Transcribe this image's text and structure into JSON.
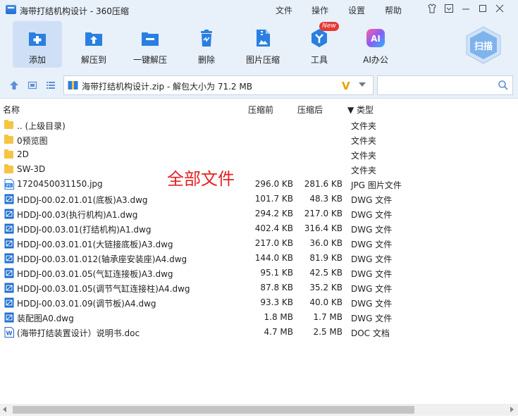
{
  "window": {
    "title": "海带打结机构设计 - 360压缩"
  },
  "menu": [
    "文件",
    "操作",
    "设置",
    "帮助"
  ],
  "toolbar": [
    {
      "label": "添加",
      "icon": "add-icon"
    },
    {
      "label": "解压到",
      "icon": "extract-to-icon"
    },
    {
      "label": "一键解压",
      "icon": "one-click-extract-icon"
    },
    {
      "label": "删除",
      "icon": "delete-icon"
    },
    {
      "label": "图片压缩",
      "icon": "image-compress-icon"
    },
    {
      "label": "工具",
      "icon": "tools-icon",
      "badge": "New"
    },
    {
      "label": "AI办公",
      "icon": "ai-office-icon"
    }
  ],
  "scan": {
    "label": "扫描"
  },
  "address": {
    "text": "海带打结机构设计.zip - 解包大小为 71.2 MB"
  },
  "search": {
    "placeholder": "",
    "value": ""
  },
  "columns": {
    "name": "名称",
    "compressed": "压缩前",
    "original": "压缩后",
    "type": "▼ 类型"
  },
  "overlay": "全部文件",
  "files": [
    {
      "name": ".. (上级目录)",
      "compressed": "",
      "original": "",
      "type": "文件夹",
      "kind": "folder"
    },
    {
      "name": "0预览图",
      "compressed": "",
      "original": "",
      "type": "文件夹",
      "kind": "folder"
    },
    {
      "name": "2D",
      "compressed": "",
      "original": "",
      "type": "文件夹",
      "kind": "folder"
    },
    {
      "name": "SW-3D",
      "compressed": "",
      "original": "",
      "type": "文件夹",
      "kind": "folder"
    },
    {
      "name": "1720450031150.jpg",
      "compressed": "296.0 KB",
      "original": "281.6 KB",
      "type": "JPG 图片文件",
      "kind": "jpg"
    },
    {
      "name": "HDDJ-00.02.01.01(底板)A3.dwg",
      "compressed": "101.7 KB",
      "original": "48.3 KB",
      "type": "DWG 文件",
      "kind": "dwg"
    },
    {
      "name": "HDDJ-00.03(执行机构)A1.dwg",
      "compressed": "294.2 KB",
      "original": "217.0 KB",
      "type": "DWG 文件",
      "kind": "dwg"
    },
    {
      "name": "HDDJ-00.03.01(打结机构)A1.dwg",
      "compressed": "402.4 KB",
      "original": "316.4 KB",
      "type": "DWG 文件",
      "kind": "dwg"
    },
    {
      "name": "HDDJ-00.03.01.01(大链接底板)A3.dwg",
      "compressed": "217.0 KB",
      "original": "36.0 KB",
      "type": "DWG 文件",
      "kind": "dwg"
    },
    {
      "name": "HDDJ-00.03.01.012(轴承座安装座)A4.dwg",
      "compressed": "144.0 KB",
      "original": "81.9 KB",
      "type": "DWG 文件",
      "kind": "dwg"
    },
    {
      "name": "HDDJ-00.03.01.05(气缸连接板)A3.dwg",
      "compressed": "95.1 KB",
      "original": "42.5 KB",
      "type": "DWG 文件",
      "kind": "dwg"
    },
    {
      "name": "HDDJ-00.03.01.05(调节气缸连接柱)A4.dwg",
      "compressed": "87.8 KB",
      "original": "35.2 KB",
      "type": "DWG 文件",
      "kind": "dwg"
    },
    {
      "name": "HDDJ-00.03.01.09(调节板)A4.dwg",
      "compressed": "93.3 KB",
      "original": "40.0 KB",
      "type": "DWG 文件",
      "kind": "dwg"
    },
    {
      "name": "装配图A0.dwg",
      "compressed": "1.8 MB",
      "original": "1.7 MB",
      "type": "DWG 文件",
      "kind": "dwg"
    },
    {
      "name": "(海带打结装置设计）说明书.doc",
      "compressed": "4.7 MB",
      "original": "2.5 MB",
      "type": "DOC 文档",
      "kind": "doc"
    }
  ]
}
